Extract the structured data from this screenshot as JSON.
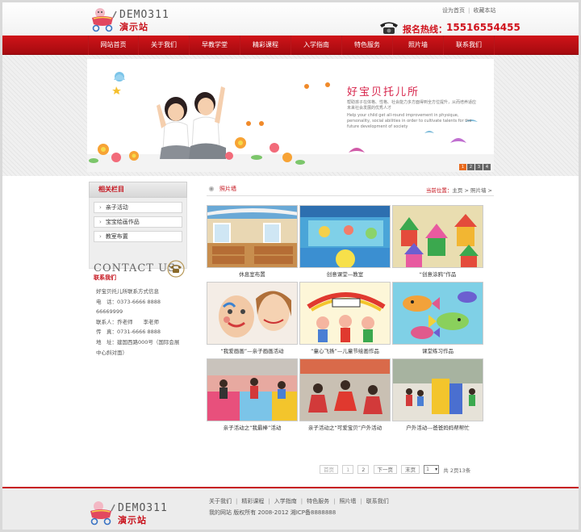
{
  "site": {
    "brand": "DEMO311",
    "subtitle": "演示站"
  },
  "toplinks": [
    "设为首页",
    "收藏本站"
  ],
  "hotline": {
    "label": "报名热线：",
    "number": "15516554455"
  },
  "nav": [
    "网站首页",
    "关于我们",
    "早教学堂",
    "精彩课程",
    "入学指南",
    "特色服务",
    "照片墙",
    "联系我们"
  ],
  "banner": {
    "title": "好宝贝托儿所",
    "text_cn": "帮助孩子在体格、性格、社会能力多方面得到全方位提升，从而培养适应未来社会发展的优秀人才",
    "text_en": "Help your child get all-round improvement in physique, personality, social abilities in order to cultivate talents for the future development of society",
    "dots": [
      "1",
      "2",
      "3",
      "4"
    ]
  },
  "sidebar": {
    "heading": "相关栏目",
    "items": [
      "亲子活动",
      "宝宝绘画作品",
      "教室布置"
    ],
    "contact_title": "CONTACT US",
    "contact_subtitle": "联系我们",
    "contact_lines": [
      "好宝贝托儿所联系方式信息",
      "电　话：0373-6666 8888",
      "66669999",
      "联系人：乔老师　　李老师",
      "传　真：0731-6666 8888",
      "地　址：建国西路000号（国际会展",
      "中心斜对面）"
    ]
  },
  "main": {
    "title": "照片墙",
    "crumb_label": "当前位置：",
    "crumb_home": "主页",
    "crumb_sep": ">",
    "crumb_current": "照片墙",
    "crumb_end": ">"
  },
  "gallery": [
    {
      "caption": "休息室布置",
      "theme": "bedroom"
    },
    {
      "caption": "创意课堂—教室",
      "theme": "classroom"
    },
    {
      "caption": "“创意涂鸦”作品",
      "theme": "houses"
    },
    {
      "caption": "“我爱画画”—亲子画画活动",
      "theme": "facepaint"
    },
    {
      "caption": "“童心飞扬”—儿童节绘画作品",
      "theme": "childrensday"
    },
    {
      "caption": "课堂练习作品",
      "theme": "fish"
    },
    {
      "caption": "亲子活动之“我最棒”活动",
      "theme": "gym"
    },
    {
      "caption": "亲子活动之“可爱宝贝”户外活动",
      "theme": "outdoor"
    },
    {
      "caption": "户外活动---爸爸妈妈帮帮忙",
      "theme": "outdoor2"
    }
  ],
  "pager": {
    "first": "首页",
    "prev": "1",
    "current": "2",
    "next": "下一页",
    "last": "末页",
    "select_value": "1",
    "summary": "共 2页13条"
  },
  "footer": {
    "links": [
      "关于我们",
      "精彩课程",
      "入学指南",
      "特色服务",
      "照片墙",
      "联系我们"
    ],
    "copyright": "我的网站 版权所有 2008-2012 湘ICP备8888888"
  },
  "colors": {
    "brand_red": "#c8101a",
    "nav_red": "#c0121a",
    "accent_orange": "#e86a1d"
  }
}
